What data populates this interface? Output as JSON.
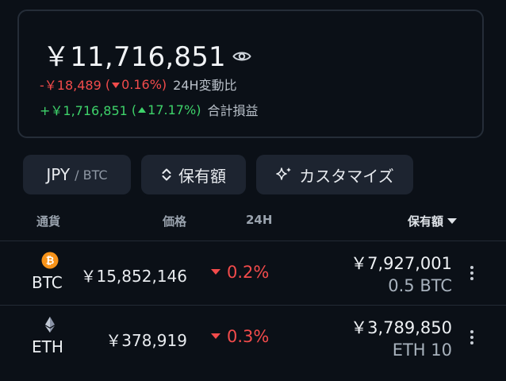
{
  "summary": {
    "total": "￥11,716,851",
    "change_24h": {
      "amount": "-￥18,489",
      "percent": "0.16%",
      "label": "24H変動比"
    },
    "change_total": {
      "amount": "+￥1,716,851",
      "percent": "17.17%",
      "label": "合計損益"
    }
  },
  "controls": {
    "currency_primary": "JPY",
    "currency_secondary": "/ BTC",
    "sort_label": "保有額",
    "customize_label": "カスタマイズ"
  },
  "table": {
    "headers": {
      "coin": "通貨",
      "price": "価格",
      "change": "24H",
      "holding": "保有額"
    },
    "rows": [
      {
        "symbol": "BTC",
        "price": "￥15,852,146",
        "change": "0.2%",
        "value": "￥7,927,001",
        "quantity": "0.5 BTC"
      },
      {
        "symbol": "ETH",
        "price": "￥378,919",
        "change": "0.3%",
        "value": "￥3,789,850",
        "quantity": "ETH 10"
      }
    ]
  },
  "colors": {
    "background": "#0b1017",
    "negative": "#f24b4b",
    "positive": "#3ed26a",
    "btc": "#f7931a",
    "button": "#1d2430"
  }
}
